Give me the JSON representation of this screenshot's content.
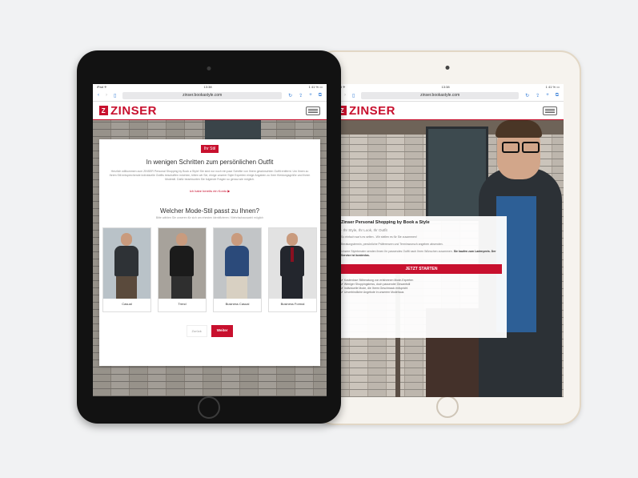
{
  "brand": {
    "name": "ZINSER",
    "logo_mark": "Z",
    "accent": "#c8102e"
  },
  "left_device": {
    "status_left": "iPad ✈",
    "status_time": "13:38",
    "status_right": "1 41 % ▭",
    "url": "zinser.bookastyle.com",
    "modal": {
      "tag": "Ihr Stil",
      "title": "In wenigen Schritten zum persönlichen Outfit",
      "intro": "Herzlich willkommen zum ZINSER Personal Shopping by Book a Style! Sie sind nur noch ein paar Schritte von Ihrem gewünschten Outfit entfernt. Um Ihnen zu Ihrem Stil entsprechende individuelle Outfits beschaffen möchten, bitten wir Sie, einige unserer Style Experten einige Angaben zu Ihrer Kleidungsgröße und Ihrem Modestil. Dafür beantworten Sie folgende Fragen so genau wie möglich.",
      "link": "Ich habe bereits ein Konto ▶",
      "question": "Welcher Mode-Stil passt zu Ihnen?",
      "question_sub": "Bitte wählen Sie unseren für sich am ehesten identifizieren / Mehrfachauswahl möglich",
      "styles": [
        {
          "label": "Casual",
          "jacket": "#2e3236",
          "pants": "#5a4a3c"
        },
        {
          "label": "Trend",
          "jacket": "#1b1b1b",
          "pants": "#2f2f2f"
        },
        {
          "label": "Business Casual",
          "jacket": "#2b4a7a",
          "pants": "#d8d0c2"
        },
        {
          "label": "Business Formal",
          "jacket": "#23262d",
          "pants": "#23262d"
        }
      ],
      "back": "Zurück",
      "next": "Weiter"
    }
  },
  "right_device": {
    "status_left": "iPad ✈",
    "status_time": "13:38",
    "status_right": "1 41 % ▭",
    "url": "zinser.bookastyle.com",
    "box": {
      "title": "Zinser Personal Shopping by Book a Style",
      "subtitle": "- Ihr Style, Ihr Look, Ihr Outfit",
      "text1": "So einfach war's es selten - Wir stellen es für Sie zusammen!",
      "text2": "Beratungstermin, persönliche Präferenzen und Terminwunsch angeben absenden.",
      "text3": "Unsere Styleberater senden Ihnen Ihr passendes Outfit nach Ihren Wünschen zusammen.",
      "text3_bold": "Sie kaufen zum Ladenpreis. Der Service ist kostenlos.",
      "cta": "JETZT STARTEN",
      "bullets": [
        "Kostenlose Stilberatung von erfahrenen Mode-Experten",
        "Weniger Shoppingstress, doch passender Gesamtstil",
        "Individuelle Mode, die Ihrem Geschmack entspricht",
        "Unverbindliche Angebote in unserem Modehaus"
      ]
    }
  }
}
